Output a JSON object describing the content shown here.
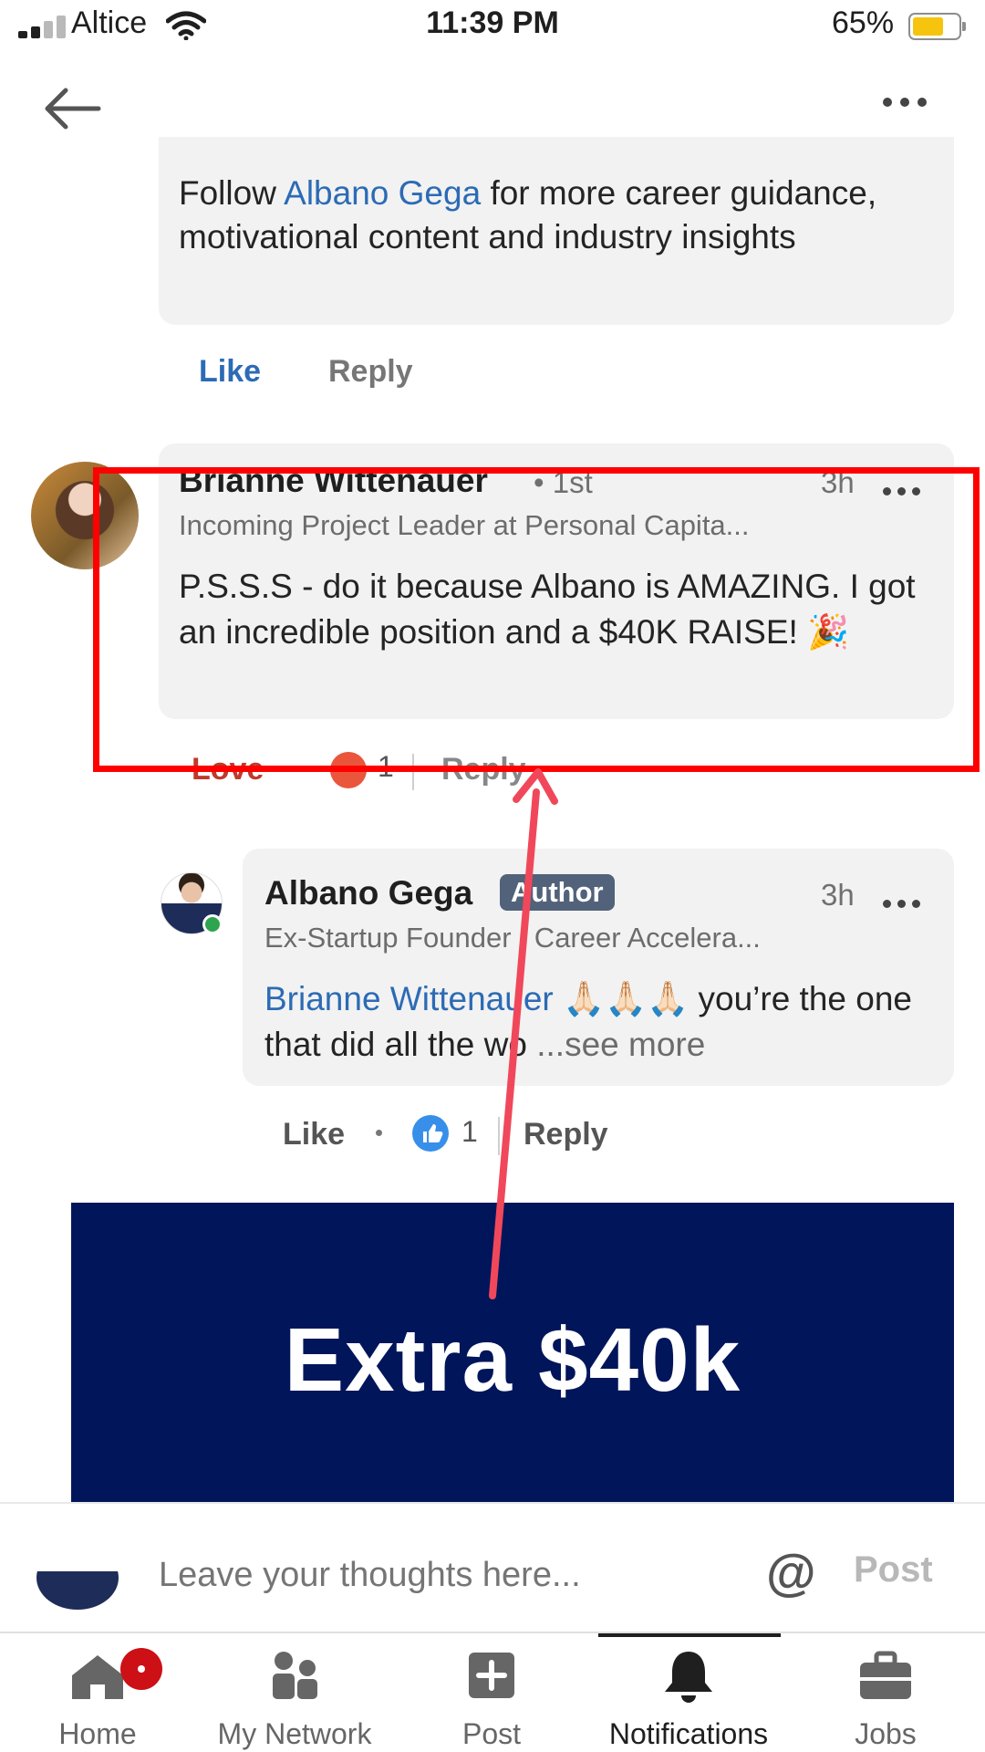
{
  "status_bar": {
    "carrier": "Altice",
    "time": "11:39 PM",
    "battery": "65%"
  },
  "comments": [
    {
      "text_before": "Follow ",
      "link": "Albano Gega",
      "text_after": " for more career guidance, motivational content and industry insights",
      "like_label": "Like",
      "reply_label": "Reply"
    },
    {
      "name": "Brianne Wittenauer",
      "degree": "• 1st",
      "time": "3h",
      "headline": "Incoming Project Leader at Personal Capita...",
      "text": "P.S.S.S - do it because Albano is AMAZING. I got an incredible position and a $40K RAISE! 🎉",
      "reaction_label": "Love",
      "reaction_count": "1",
      "reply_label": "Reply"
    }
  ],
  "reply": {
    "name": "Albano Gega",
    "badge": "Author",
    "time": "3h",
    "headline": "Ex-Startup Founder | Career Accelera...",
    "mention": "Brianne Wittenauer",
    "text": " 🙏🏻🙏🏻🙏🏻 you’re the one that did all the wo",
    "see_more": "  ...see more",
    "like_label": "Like",
    "like_count": "1",
    "reply_label": "Reply"
  },
  "banner": {
    "text": "Extra $40k",
    "color": "#00155a"
  },
  "composer": {
    "placeholder": "Leave your thoughts here...",
    "at_label": "@",
    "post_label": "Post"
  },
  "bottom_nav": {
    "tabs": [
      {
        "label": "Home",
        "icon": "home-icon"
      },
      {
        "label": "My Network",
        "icon": "network-icon"
      },
      {
        "label": "Post",
        "icon": "post-plus-icon"
      },
      {
        "label": "Notifications",
        "icon": "bell-icon",
        "active": true
      },
      {
        "label": "Jobs",
        "icon": "briefcase-icon"
      }
    ]
  },
  "colors": {
    "highlight": "#ff0000",
    "arrow": "#f0485a",
    "link": "#2c6bb5"
  }
}
